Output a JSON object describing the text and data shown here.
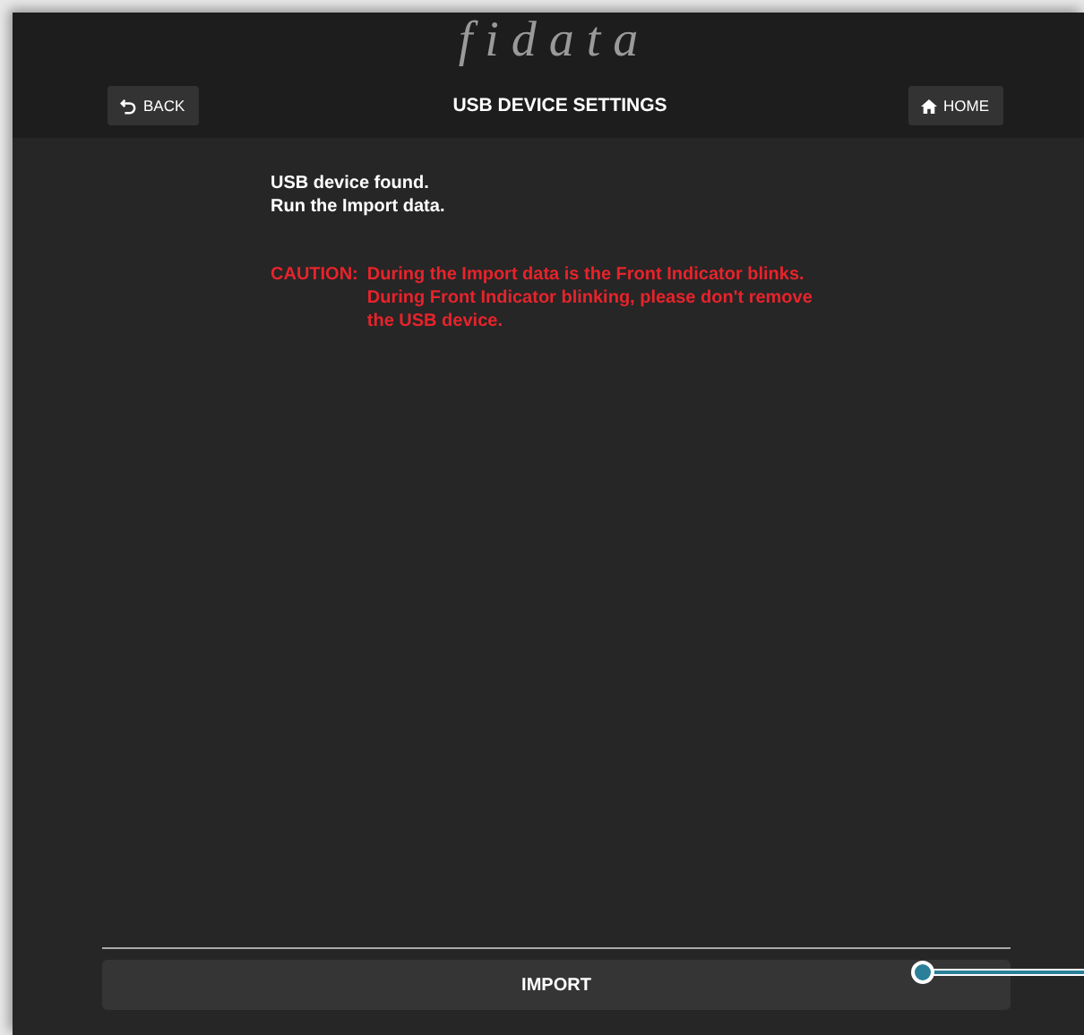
{
  "logo": "fidata",
  "header": {
    "back": "BACK",
    "title": "USB DEVICE SETTINGS",
    "home": "HOME"
  },
  "message": [
    "USB device found.",
    "Run the Import data."
  ],
  "caution": {
    "label": "CAUTION:",
    "lines": [
      "During the Import data is the Front Indicator blinks.",
      "During Front Indicator blinking, please don't remove",
      "the USB device."
    ]
  },
  "import_button": "IMPORT"
}
